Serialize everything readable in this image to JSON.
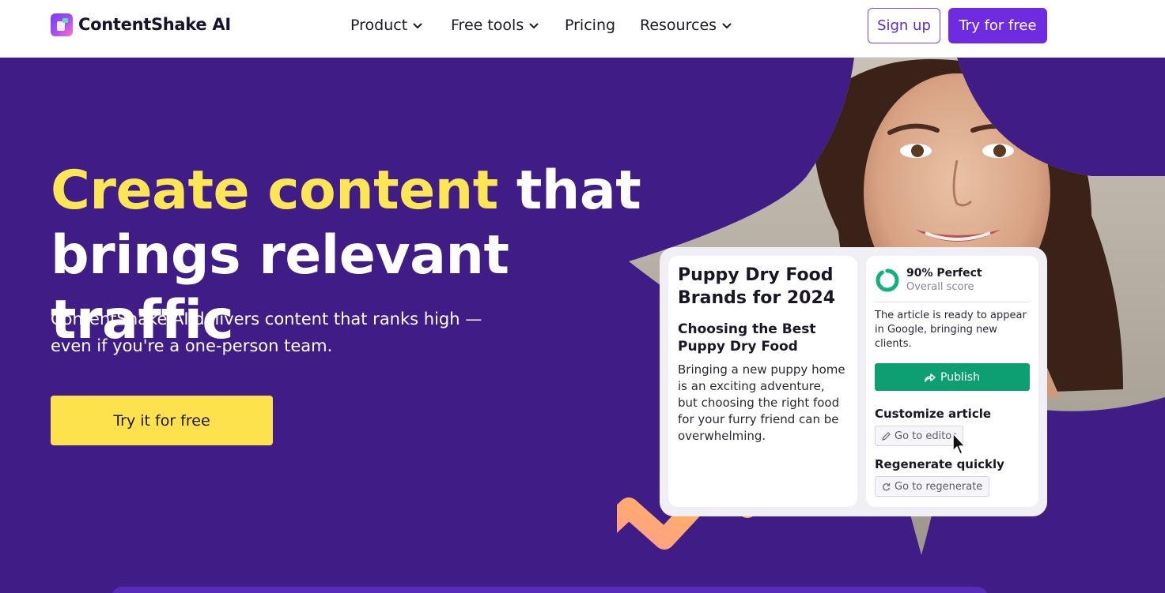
{
  "brand": {
    "name": "ContentShake AI"
  },
  "nav": {
    "items": [
      {
        "label": "Product",
        "has_dropdown": true
      },
      {
        "label": "Free tools",
        "has_dropdown": true
      },
      {
        "label": "Pricing",
        "has_dropdown": false
      },
      {
        "label": "Resources",
        "has_dropdown": true
      }
    ],
    "sign_up_label": "Sign up",
    "try_free_label": "Try for free"
  },
  "hero": {
    "headline_highlight": "Create content",
    "headline_rest_1": " that",
    "headline_rest_2": "brings relevant traffic",
    "subtext_1": "ContentShake AI delivers content that ranks high —",
    "subtext_2": "even if you're a one-person team.",
    "cta_label": "Try it for free"
  },
  "card": {
    "article_title": "Puppy Dry Food Brands for 2024",
    "section_heading": "Choosing the Best Puppy Dry Food",
    "body": "Bringing a new puppy home is an exciting adventure, but choosing the right food for your furry friend can be overwhelming.",
    "score_value": "90% Perfect",
    "score_fraction": 0.9,
    "score_label": "Overall score",
    "ready_text": "The article is ready to appear in Google, bringing new clients.",
    "publish_label": "Publish",
    "customize_heading": "Customize article",
    "editor_label": "Go to editor",
    "regenerate_heading": "Regenerate quickly",
    "regenerate_label": "Go to regenerate"
  },
  "colors": {
    "hero_bg": "#3f1c86",
    "headline_highlight": "#fde656",
    "cta_bg": "#fde24e",
    "primary_purple": "#6f2bdf",
    "publish_green": "#0d9e72"
  }
}
